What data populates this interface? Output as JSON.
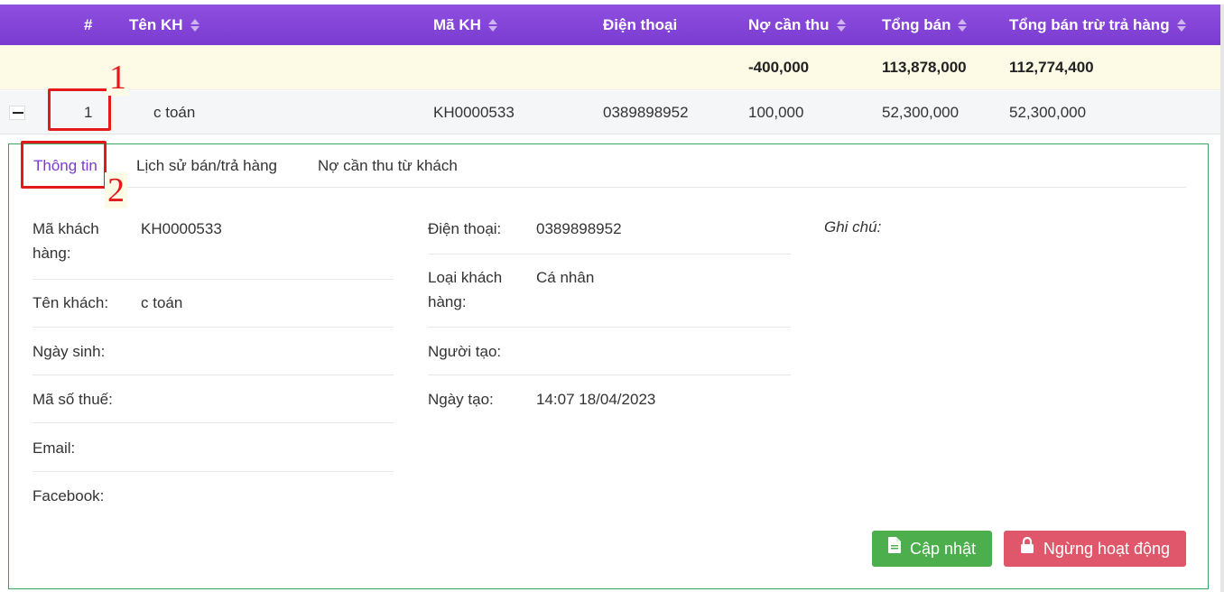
{
  "table": {
    "columns": [
      {
        "key": "index",
        "label": "#",
        "sortable": false
      },
      {
        "key": "name",
        "label": "Tên KH",
        "sortable": true
      },
      {
        "key": "code",
        "label": "Mã KH",
        "sortable": true
      },
      {
        "key": "phone",
        "label": "Điện thoại",
        "sortable": false
      },
      {
        "key": "debt",
        "label": "Nợ cần thu",
        "sortable": true
      },
      {
        "key": "total_sales",
        "label": "Tổng bán",
        "sortable": true
      },
      {
        "key": "net_sales",
        "label": "Tổng bán trừ trả hàng",
        "sortable": true
      }
    ],
    "totals": {
      "debt": "-400,000",
      "total_sales": "113,878,000",
      "net_sales": "112,774,400"
    },
    "rows": [
      {
        "index": "1",
        "name": "c toán",
        "code": "KH0000533",
        "phone": "0389898952",
        "debt": "100,000",
        "total_sales": "52,300,000",
        "net_sales": "52,300,000"
      }
    ]
  },
  "annotations": {
    "first": "1",
    "second": "2"
  },
  "detail": {
    "tabs": [
      {
        "label": "Thông tin",
        "active": true
      },
      {
        "label": "Lịch sử bán/trả hàng",
        "active": false
      },
      {
        "label": "Nợ cần thu từ khách",
        "active": false
      }
    ],
    "left_fields": [
      {
        "label": "Mã khách hàng:",
        "value": "KH0000533"
      },
      {
        "label": "Tên khách:",
        "value": "c toán"
      },
      {
        "label": "Ngày sinh:",
        "value": ""
      },
      {
        "label": "Mã số thuế:",
        "value": ""
      },
      {
        "label": "Email:",
        "value": ""
      },
      {
        "label": "Facebook:",
        "value": ""
      }
    ],
    "middle_fields": [
      {
        "label": "Điện thoại:",
        "value": "0389898952"
      },
      {
        "label": "Loại khách hàng:",
        "value": "Cá nhân"
      },
      {
        "label": "Người tạo:",
        "value": ""
      },
      {
        "label": "Ngày tạo:",
        "value": "14:07 18/04/2023"
      }
    ],
    "note_label": "Ghi chú:",
    "buttons": {
      "update": "Cập nhật",
      "deactivate": "Ngừng hoạt động"
    }
  },
  "colors": {
    "header": "#7a3bd0",
    "accent": "#7a3bd0",
    "total_row": "#fdfae6",
    "update_button": "#4cae4c",
    "deactivate_button": "#e0566a",
    "annotation": "#e41a1a",
    "detail_border": "#3aa862"
  }
}
